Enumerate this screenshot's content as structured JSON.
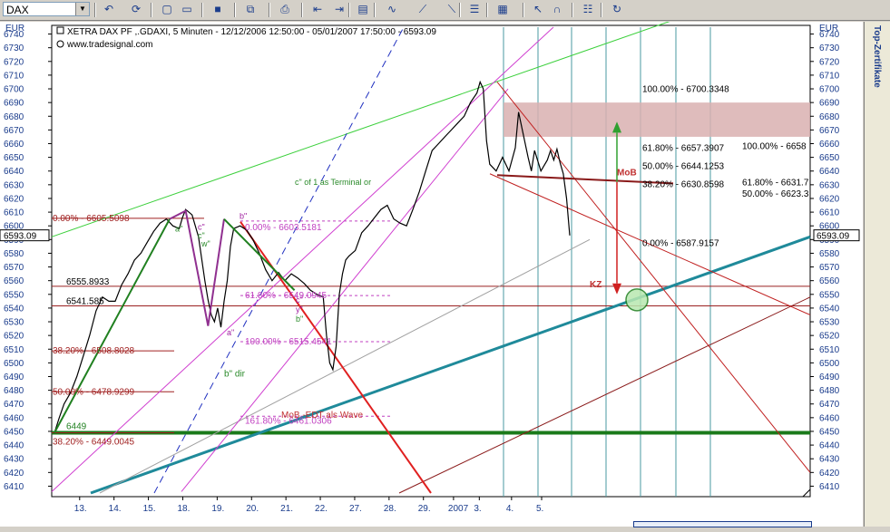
{
  "toolbar": {
    "symbol": "DAX",
    "icons": [
      "back-icon",
      "refresh-icon",
      "new-icon",
      "open-icon",
      "save-icon",
      "copy-icon",
      "print-icon",
      "chart-left-icon",
      "chart-right-icon",
      "window-icon",
      "indicator-icon",
      "drawing-icon",
      "trendline-icon",
      "properties-icon",
      "grid-icon",
      "cursor-icon",
      "magnet-icon",
      "template-icon",
      "reload-icon"
    ]
  },
  "sidebar": {
    "label": "Top-Zertifikate"
  },
  "chart_data": {
    "type": "line",
    "title": "XETRA DAX PF ,.GDAXI, 5 Minuten - 12/12/2006 12:50:00 - 05/01/2007 17:50:00 - 6593.09",
    "watermark": "www.tradesignal.com",
    "currency_left": "EUR",
    "currency_right": "EUR",
    "last_price": "6593.09",
    "ylim": [
      6405,
      6745
    ],
    "y_ticks": [
      6410,
      6420,
      6430,
      6440,
      6450,
      6460,
      6470,
      6480,
      6490,
      6500,
      6510,
      6520,
      6530,
      6540,
      6550,
      6560,
      6570,
      6580,
      6590,
      6600,
      6610,
      6620,
      6630,
      6640,
      6650,
      6660,
      6670,
      6680,
      6690,
      6700,
      6710,
      6720,
      6730,
      6740
    ],
    "x_ticks": [
      "13.",
      "14.",
      "15.",
      "18.",
      "19.",
      "20.",
      "21.",
      "22.",
      "27.",
      "28.",
      "29.",
      "2007",
      "3.",
      "4.",
      "5."
    ],
    "x_tick_pos": [
      0.065,
      0.145,
      0.225,
      0.305,
      0.385,
      0.465,
      0.545,
      0.625,
      0.705,
      0.785,
      0.865,
      0.935,
      0.995,
      1.07,
      1.14
    ],
    "grid": false,
    "price": [
      [
        0,
        6449
      ],
      [
        3,
        6460
      ],
      [
        6,
        6470
      ],
      [
        10,
        6478
      ],
      [
        14,
        6490
      ],
      [
        18,
        6505
      ],
      [
        22,
        6520
      ],
      [
        26,
        6538
      ],
      [
        30,
        6548
      ],
      [
        34,
        6545
      ],
      [
        38,
        6545
      ],
      [
        42,
        6557
      ],
      [
        46,
        6565
      ],
      [
        50,
        6575
      ],
      [
        54,
        6580
      ],
      [
        58,
        6588
      ],
      [
        62,
        6596
      ],
      [
        66,
        6602
      ],
      [
        70,
        6605
      ],
      [
        74,
        6600
      ],
      [
        78,
        6598
      ],
      [
        80,
        6606
      ],
      [
        82,
        6612
      ],
      [
        86,
        6608
      ],
      [
        90,
        6592
      ],
      [
        94,
        6560
      ],
      [
        96,
        6546
      ],
      [
        98,
        6535
      ],
      [
        100,
        6530
      ],
      [
        102,
        6540
      ],
      [
        104,
        6526
      ],
      [
        106,
        6545
      ],
      [
        108,
        6560
      ],
      [
        110,
        6585
      ],
      [
        112,
        6598
      ],
      [
        116,
        6600
      ],
      [
        120,
        6597
      ],
      [
        124,
        6590
      ],
      [
        128,
        6580
      ],
      [
        132,
        6568
      ],
      [
        136,
        6560
      ],
      [
        140,
        6566
      ],
      [
        144,
        6560
      ],
      [
        148,
        6565
      ],
      [
        152,
        6562
      ],
      [
        156,
        6558
      ],
      [
        160,
        6553
      ],
      [
        164,
        6550
      ],
      [
        168,
        6548
      ],
      [
        170,
        6520
      ],
      [
        172,
        6500
      ],
      [
        174,
        6495
      ],
      [
        176,
        6512
      ],
      [
        178,
        6550
      ],
      [
        180,
        6565
      ],
      [
        182,
        6575
      ],
      [
        184,
        6578
      ],
      [
        188,
        6582
      ],
      [
        192,
        6595
      ],
      [
        196,
        6600
      ],
      [
        200,
        6606
      ],
      [
        204,
        6612
      ],
      [
        208,
        6615
      ],
      [
        212,
        6605
      ],
      [
        216,
        6602
      ],
      [
        220,
        6600
      ],
      [
        224,
        6612
      ],
      [
        228,
        6625
      ],
      [
        232,
        6640
      ],
      [
        236,
        6655
      ],
      [
        240,
        6660
      ],
      [
        244,
        6665
      ],
      [
        248,
        6670
      ],
      [
        252,
        6675
      ],
      [
        256,
        6680
      ],
      [
        260,
        6690
      ],
      [
        264,
        6697
      ],
      [
        266,
        6705
      ],
      [
        268,
        6700
      ],
      [
        270,
        6662
      ],
      [
        272,
        6645
      ],
      [
        276,
        6640
      ],
      [
        280,
        6650
      ],
      [
        284,
        6640
      ],
      [
        288,
        6657
      ],
      [
        290,
        6683
      ],
      [
        292,
        6672
      ],
      [
        296,
        6650
      ],
      [
        298,
        6640
      ],
      [
        300,
        6655
      ],
      [
        304,
        6640
      ],
      [
        308,
        6648
      ],
      [
        310,
        6655
      ],
      [
        312,
        6648
      ],
      [
        314,
        6656
      ],
      [
        316,
        6646
      ],
      [
        318,
        6638
      ],
      [
        320,
        6620
      ],
      [
        322,
        6593
      ]
    ],
    "fib_left": [
      {
        "pct": "0.00%",
        "value": 6605.5098,
        "label": "0.00% - 6605.5098"
      },
      {
        "pct": "38.20%",
        "value": 6508.8028,
        "label": "38.20% - 6508.8028"
      },
      {
        "pct": "50.00%",
        "value": 6478.9299,
        "label": "50.00% - 6478.9299"
      },
      {
        "pct": "38.20%",
        "value": 6449.0045,
        "label": "38.20% - 6449.0045"
      }
    ],
    "fib_mid": [
      {
        "value": 6603.5181,
        "label": "0.00% - 6603.5181"
      },
      {
        "value": 6549.0945,
        "label": "61.80% - 6549.0945"
      },
      {
        "value": 6515.4541,
        "label": "100.00% - 6515.4541"
      },
      {
        "value": 6461.0306,
        "label": "161.80% - 6461.0306"
      }
    ],
    "fib_right": [
      {
        "value": 6700.3348,
        "label": "100.00% - 6700.3348"
      },
      {
        "value": 6657.3907,
        "label": "61.80% - 6657.3907"
      },
      {
        "value": 6644.1253,
        "label": "50.00% - 6644.1253"
      },
      {
        "value": 6630.8598,
        "label": "38.20% - 6630.8598"
      },
      {
        "value": 6587.9157,
        "label": "0.00% - 6587.9157"
      }
    ],
    "fib_far_right": [
      {
        "value": 6658,
        "label": "100.00% - 6658"
      },
      {
        "value": 6631.7,
        "label": "61.80% - 6631.7"
      },
      {
        "value": 6623.3,
        "label": "50.00% - 6623.3"
      }
    ],
    "levels": [
      {
        "value": 6555.8933,
        "label": "6555.8933"
      },
      {
        "value": 6541.585,
        "label": "6541.585"
      },
      {
        "value": 6449,
        "label": "6449"
      }
    ],
    "annotations": [
      {
        "text": "c\" of 1 as Terminal or",
        "color": "#2a8a2a"
      },
      {
        "text": "MoB -EDT als Wave",
        "color": "#c03030"
      },
      {
        "text": "MoB",
        "color": "#c03030"
      },
      {
        "text": "KZ",
        "color": "#c03030"
      },
      {
        "text": "b\" dir",
        "color": "#2a8a2a"
      },
      {
        "text": "a\"",
        "color": "#2a8a2a"
      },
      {
        "text": "b\"",
        "color": "#a020a0"
      },
      {
        "text": "a\"",
        "color": "#a020a0"
      },
      {
        "text": "c\"",
        "color": "#a020a0"
      },
      {
        "text": "c\"",
        "color": "#2a8a2a"
      },
      {
        "text": "w\"",
        "color": "#2a8a2a"
      },
      {
        "text": "c\"",
        "color": "#a020a0"
      },
      {
        "text": "y\"",
        "color": "#a020a0"
      },
      {
        "text": "b\"",
        "color": "#2a8a2a"
      }
    ]
  }
}
